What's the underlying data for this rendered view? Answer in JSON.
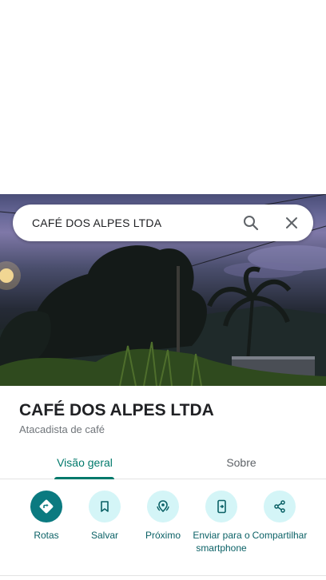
{
  "search": {
    "query": "CAFÉ DOS ALPES LTDA"
  },
  "place": {
    "name": "CAFÉ DOS ALPES LTDA",
    "category": "Atacadista de café"
  },
  "tabs": [
    {
      "label": "Visão geral",
      "active": true
    },
    {
      "label": "Sobre",
      "active": false
    }
  ],
  "actions": [
    {
      "label": "Rotas",
      "icon": "directions-icon"
    },
    {
      "label": "Salvar",
      "icon": "bookmark-icon"
    },
    {
      "label": "Próximo",
      "icon": "nearby-icon"
    },
    {
      "label": "Enviar para o smartphone",
      "icon": "send-to-phone-icon"
    },
    {
      "label": "Compartilhar",
      "icon": "share-icon"
    }
  ],
  "colors": {
    "accent": "#00796b",
    "action_bg": "#d4f5f7",
    "primary_action_bg": "#0b7a80"
  }
}
